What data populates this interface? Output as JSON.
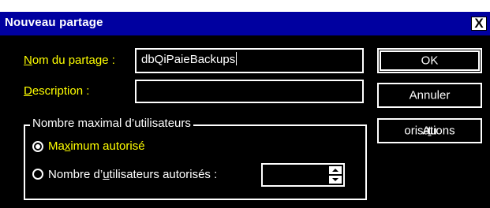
{
  "window": {
    "title": "Nouveau partage",
    "close_glyph": "X"
  },
  "form": {
    "share_name_label_hot": "N",
    "share_name_label_rest": "om du partage :",
    "share_name_value": "dbQiPaieBackups",
    "description_label_hot": "D",
    "description_label_rest": "escription :",
    "description_value": ""
  },
  "buttons": {
    "ok": "OK",
    "cancel": "Annuler",
    "permissions_pre": "Au",
    "permissions_hot": "t",
    "permissions_post": "orisations"
  },
  "user_limit": {
    "group_title": "Nombre maximal d’utilisateurs",
    "max_allowed_pre": "Ma",
    "max_allowed_hot": "x",
    "max_allowed_post": "imum autorisé",
    "max_allowed_selected": true,
    "allow_n_pre": "Nombre d’",
    "allow_n_hot": "u",
    "allow_n_post": "tilisateurs autorisés :",
    "allow_n_value": ""
  },
  "icons": {
    "close": "close-icon",
    "spin_up": "chevron-up-icon",
    "spin_down": "chevron-down-icon"
  },
  "colors": {
    "titlebar": "#0000a0",
    "background": "#000000",
    "label_accent": "#ffff00",
    "text": "#ffffff"
  }
}
